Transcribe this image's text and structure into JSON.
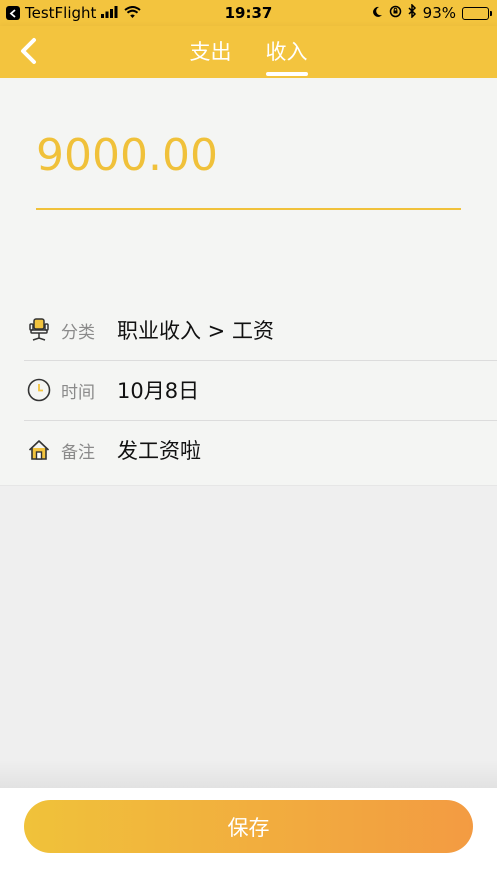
{
  "status_bar": {
    "app": "TestFlight",
    "time": "19:37",
    "battery_text": "93%",
    "battery_level": 0.93
  },
  "nav": {
    "tabs": [
      {
        "label": "支出",
        "active": false
      },
      {
        "label": "收入",
        "active": true
      }
    ]
  },
  "amount": "9000.00",
  "details": [
    {
      "icon": "chair-icon",
      "label": "分类",
      "value": "职业收入 > 工资"
    },
    {
      "icon": "clock-icon",
      "label": "时间",
      "value": "10月8日"
    },
    {
      "icon": "house-icon",
      "label": "备注",
      "value": "发工资啦"
    }
  ],
  "save_label": "保存",
  "colors": {
    "accent": "#f3c43e",
    "amount": "#f0c13a",
    "gradient_start": "#f0c23a",
    "gradient_end": "#f39b42"
  }
}
